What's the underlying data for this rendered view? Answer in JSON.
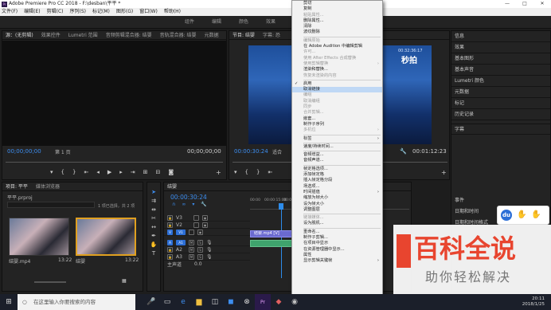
{
  "titlebar": {
    "title": "Adobe Premiere Pro CC 2018 - F:\\desban\\平平 *",
    "min": "—",
    "max": "□",
    "close": "✕"
  },
  "menubar": [
    "文件(F)",
    "编辑(E)",
    "剪辑(C)",
    "序列(S)",
    "标记(M)",
    "图形(G)",
    "窗口(W)",
    "帮助(H)"
  ],
  "workspaces": [
    "组件",
    "编辑",
    "颜色",
    "效果",
    "音频",
    "图形",
    "库"
  ],
  "source_panel": {
    "tabs": [
      "源：(无剪辑)",
      "效果控件",
      "Lumetri 范围",
      "音频剪辑混合器: 结婴",
      "音轨混合器: 结婴",
      "元数据"
    ],
    "timecode_left": "00;00;00;00",
    "page": "第 1 页",
    "timecode_right": "00;00;00;00"
  },
  "program_panel": {
    "tabs": [
      "节目: 结婴",
      "字幕: 恐"
    ],
    "timecode_left": "00:00:30:24",
    "fit": "适合",
    "timecode_right": "00:01:12:23",
    "video_overlay": {
      "time": "00:32:36:17",
      "logo": "秒拍"
    }
  },
  "project_panel": {
    "tabs": [
      "项目: 平平",
      "媒体浏览器"
    ],
    "project_name": "平平.prproj",
    "selection_info": "1 项已选择，共 2 项",
    "items": [
      {
        "name": "结婴.mp4",
        "duration": "13:22"
      },
      {
        "name": "结婴",
        "duration": "13:22"
      }
    ]
  },
  "timeline": {
    "tab": "结婴",
    "timecode": "00:00:30:24",
    "ruler": [
      "00:00",
      "00:00:15:00",
      "00:00:30:00"
    ],
    "video_tracks": [
      "V3",
      "V2",
      "V1"
    ],
    "audio_tracks": [
      "A1",
      "A2",
      "A3"
    ],
    "clip_label": "结婴.mp4 [V]",
    "master_label": "主声道",
    "master_value": "0.0"
  },
  "right_panel": {
    "items": [
      "信息",
      "效果",
      "基本图形",
      "基本声音",
      "Lumetri 颜色",
      "元数据",
      "标记",
      "历史记录"
    ],
    "sub_header": "字幕",
    "lower_header": "事件",
    "lower_items": [
      "日期和时间",
      "日期和时间格式"
    ]
  },
  "context_menu": {
    "items": [
      {
        "label": "剪切",
        "state": "normal"
      },
      {
        "label": "复制",
        "state": "normal"
      },
      {
        "label": "粘贴属性...",
        "state": "disabled"
      },
      {
        "label": "删除属性...",
        "state": "normal"
      },
      {
        "label": "清除",
        "state": "normal"
      },
      {
        "label": "波纹删除",
        "state": "normal"
      },
      {
        "sep": true
      },
      {
        "label": "编辑原始",
        "state": "disabled"
      },
      {
        "label": "在 Adobe Audition 中编辑剪辑",
        "state": "normal"
      },
      {
        "label": "许可...",
        "state": "disabled"
      },
      {
        "label": "使用 After Effects 合成替换",
        "state": "disabled"
      },
      {
        "label": "使用剪辑替换",
        "state": "disabled",
        "submenu": true
      },
      {
        "label": "渲染和替换...",
        "state": "normal"
      },
      {
        "label": "恢复未渲染的内容",
        "state": "disabled"
      },
      {
        "sep": true
      },
      {
        "label": "启用",
        "state": "normal",
        "checked": true
      },
      {
        "label": "取消链接",
        "state": "highlight"
      },
      {
        "label": "编组",
        "state": "disabled"
      },
      {
        "label": "取消编组",
        "state": "disabled"
      },
      {
        "label": "同步",
        "state": "disabled"
      },
      {
        "label": "合并剪辑...",
        "state": "disabled"
      },
      {
        "label": "嵌套...",
        "state": "normal"
      },
      {
        "label": "制作子序列",
        "state": "normal"
      },
      {
        "label": "多机位",
        "state": "disabled",
        "submenu": true
      },
      {
        "sep": true
      },
      {
        "label": "标签",
        "state": "normal",
        "submenu": true
      },
      {
        "sep": true
      },
      {
        "label": "速度/持续时间...",
        "state": "normal"
      },
      {
        "sep": true
      },
      {
        "label": "音频增益...",
        "state": "normal"
      },
      {
        "label": "音频声道...",
        "state": "normal"
      },
      {
        "sep": true
      },
      {
        "label": "帧定格选项...",
        "state": "normal"
      },
      {
        "label": "添加帧定格",
        "state": "normal"
      },
      {
        "label": "插入帧定格分段",
        "state": "normal"
      },
      {
        "label": "场选项...",
        "state": "normal"
      },
      {
        "label": "时间插值",
        "state": "normal",
        "submenu": true
      },
      {
        "label": "缩放为帧大小",
        "state": "normal"
      },
      {
        "label": "设为帧大小",
        "state": "normal"
      },
      {
        "label": "调整图层",
        "state": "normal"
      },
      {
        "sep": true
      },
      {
        "label": "链接媒体...",
        "state": "disabled"
      },
      {
        "label": "设为脱机...",
        "state": "normal"
      },
      {
        "sep": true
      },
      {
        "label": "重命名...",
        "state": "normal"
      },
      {
        "label": "制作子剪辑...",
        "state": "normal"
      },
      {
        "label": "在项目中显示",
        "state": "normal"
      },
      {
        "label": "在资源管理器中显示...",
        "state": "normal"
      },
      {
        "label": "属性",
        "state": "normal"
      },
      {
        "label": "显示剪辑关键帧",
        "state": "normal",
        "submenu": true
      }
    ]
  },
  "taskbar": {
    "search_placeholder": "在这里输入你要搜索的内容",
    "time": "20:11",
    "date": "2018/1/25"
  },
  "watermark": {
    "title": "百科全说",
    "subtitle": "助你轻松解决",
    "du_label": "du"
  }
}
